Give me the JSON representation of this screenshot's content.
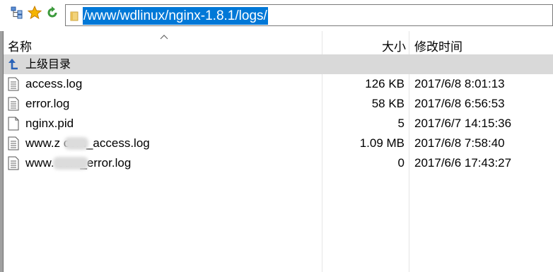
{
  "toolbar": {
    "buttons": [
      {
        "name": "tree-icon"
      },
      {
        "name": "bookmark-star-icon"
      },
      {
        "name": "refresh-icon"
      }
    ],
    "path": "/www/wdlinux/nginx-1.8.1/logs/"
  },
  "columns": {
    "name": "名称",
    "size": "大小",
    "modified": "修改时间"
  },
  "parent_row": {
    "label": "上级目录",
    "icon": "parent-dir-arrow-icon"
  },
  "files": [
    {
      "name": "access.log",
      "size": "126 KB",
      "modified": "2017/6/8 8:01:13",
      "icon": "text-file-icon"
    },
    {
      "name": "error.log",
      "size": "58 KB",
      "modified": "2017/6/8 6:56:53",
      "icon": "text-file-icon"
    },
    {
      "name": "nginx.pid",
      "size": "5",
      "modified": "2017/6/7 14:15:36",
      "icon": "blank-file-icon"
    },
    {
      "name": "www.z   com_access.log",
      "size": "1.09 MB",
      "modified": "2017/6/8 7:58:40",
      "icon": "text-file-icon"
    },
    {
      "name": "www.    com_error.log",
      "size": "0",
      "modified": "2017/6/6 17:43:27",
      "icon": "text-file-icon"
    }
  ],
  "colors": {
    "selection": "#0078d7",
    "row_highlight": "#d9d9d9",
    "grid": "#e5e5e5"
  }
}
